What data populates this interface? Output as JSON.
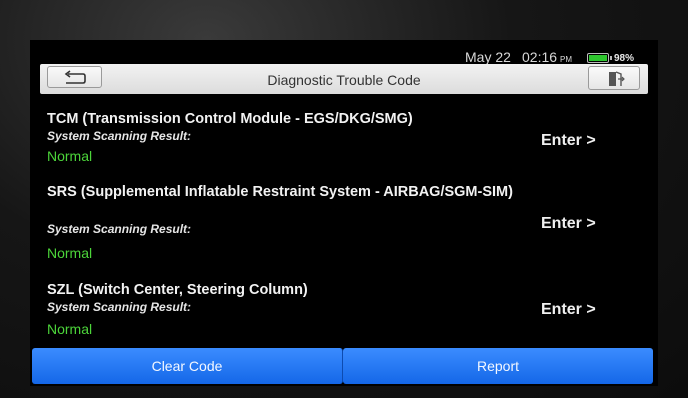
{
  "status_bar": {
    "date": "May 22",
    "time": "02:16",
    "ampm": "PM",
    "battery_percent": "98%",
    "battery_level": 0.98,
    "battery_color": "#2ec52e"
  },
  "header": {
    "title": "Diagnostic Trouble Code",
    "back_icon": "return-arrow-icon",
    "exit_icon": "exit-door-icon"
  },
  "modules": [
    {
      "name": "TCM (Transmission Control Module - EGS/DKG/SMG)",
      "scan_label": "System Scanning Result:",
      "result": "Normal",
      "action": "Enter >"
    },
    {
      "name": "SRS (Supplemental Inflatable Restraint System - AIRBAG/SGM-SIM)",
      "scan_label": "System Scanning Result:",
      "result": "Normal",
      "action": "Enter >"
    },
    {
      "name": "SZL (Switch Center, Steering Column)",
      "scan_label": "System Scanning Result:",
      "result": "Normal",
      "action": "Enter >"
    }
  ],
  "footer": {
    "clear_code": "Clear Code",
    "report": "Report"
  },
  "colors": {
    "result_ok": "#4cd53a",
    "button_blue": "#1e74f0"
  }
}
